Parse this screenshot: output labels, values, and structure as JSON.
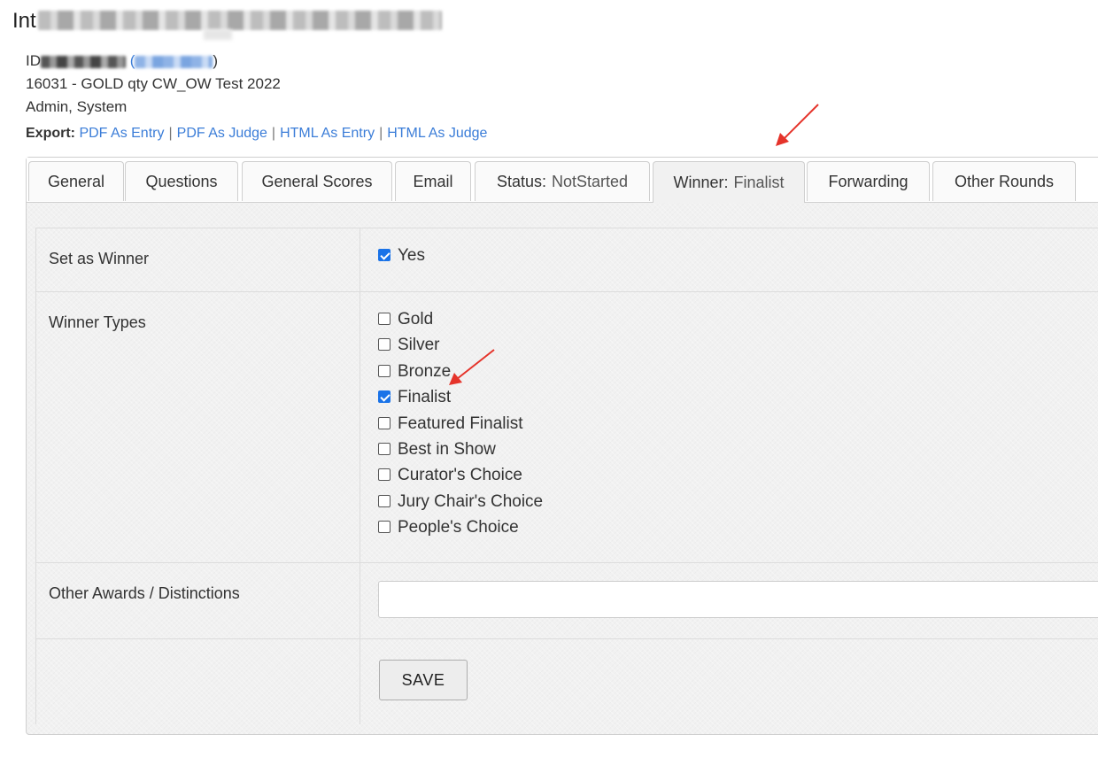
{
  "header": {
    "title_visible": "Int",
    "line1_visible_prefix": "ID",
    "line1_visible_paren": "(",
    "line1_visible_paren_close": ")",
    "entry": "16031 - GOLD qty CW_OW Test 2022",
    "user": "Admin, System"
  },
  "export": {
    "label": "Export:",
    "links": [
      "PDF As Entry",
      "PDF As Judge",
      "HTML As Entry",
      "HTML As Judge"
    ],
    "separator": "|"
  },
  "tabs": [
    {
      "label": "General"
    },
    {
      "label": "Questions"
    },
    {
      "label": "General Scores"
    },
    {
      "label": "Email"
    },
    {
      "label": "Status:",
      "value": "NotStarted"
    },
    {
      "label": "Winner:",
      "value": "Finalist",
      "active": true
    },
    {
      "label": "Forwarding"
    },
    {
      "label": "Other Rounds"
    }
  ],
  "form": {
    "set_winner": {
      "label": "Set as Winner",
      "option": "Yes",
      "checked": true
    },
    "winner_types": {
      "label": "Winner Types",
      "options": [
        {
          "label": "Gold",
          "checked": false
        },
        {
          "label": "Silver",
          "checked": false
        },
        {
          "label": "Bronze",
          "checked": false
        },
        {
          "label": "Finalist",
          "checked": true
        },
        {
          "label": "Featured Finalist",
          "checked": false
        },
        {
          "label": "Best in Show",
          "checked": false
        },
        {
          "label": "Curator's Choice",
          "checked": false
        },
        {
          "label": "Jury Chair's Choice",
          "checked": false
        },
        {
          "label": "People's Choice",
          "checked": false
        }
      ]
    },
    "other_awards": {
      "label": "Other Awards / Distinctions",
      "value": "",
      "placeholder": ""
    },
    "save_label": "SAVE"
  },
  "colors": {
    "link": "#3b7dd8",
    "checkbox": "#1a73e8",
    "annotation_arrow": "#e5332a"
  }
}
